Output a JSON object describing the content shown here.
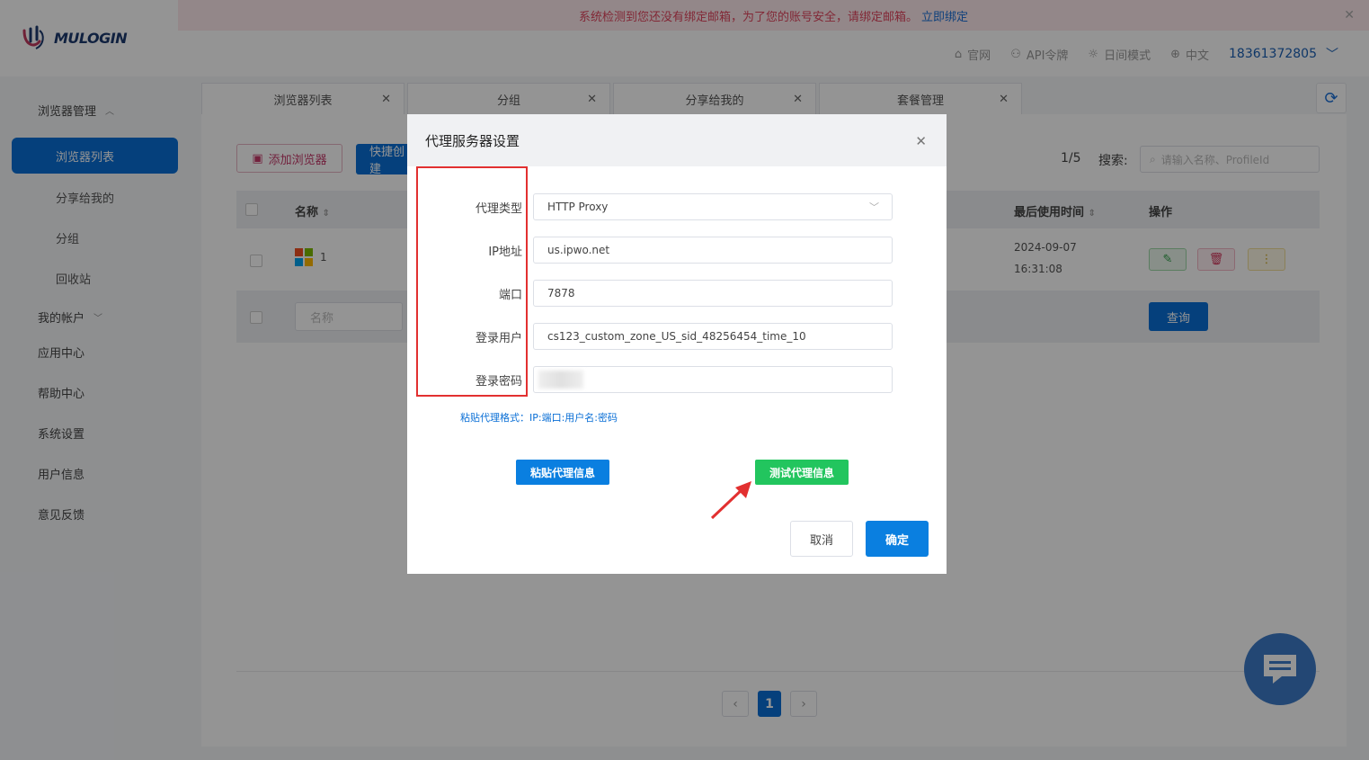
{
  "banner": {
    "message": "系统检测到您还没有绑定邮箱，为了您的账号安全，请绑定邮箱。",
    "link": "立即绑定"
  },
  "brand": {
    "name": "MULOGIN"
  },
  "topnav": {
    "items": [
      "官网",
      "API令牌",
      "日间模式",
      "中文"
    ],
    "phone": "18361372805"
  },
  "sidebar": {
    "group1": "浏览器管理",
    "active": "浏览器列表",
    "subs": [
      "分享给我的",
      "分组",
      "回收站"
    ],
    "items": [
      "我的帐户",
      "应用中心",
      "帮助中心",
      "系统设置",
      "用户信息",
      "意见反馈"
    ]
  },
  "tabs": [
    "浏览器列表",
    "分组",
    "分享给我的",
    "套餐管理"
  ],
  "toolbar": {
    "add_label": "添加浏览器",
    "quick_label": "快捷创建",
    "page_info": "1/5",
    "search_label": "搜索:",
    "search_placeholder": "请输入名称、ProfileId"
  },
  "table": {
    "headers": {
      "name": "名称",
      "last_used": "最后使用时间",
      "actions": "操作"
    },
    "row": {
      "name": "1",
      "last_used_date": "2024-09-07",
      "last_used_time": "16:31:08"
    },
    "filter_placeholder": "名称",
    "query_label": "查询"
  },
  "pagination": {
    "current": "1"
  },
  "modal": {
    "title": "代理服务器设置",
    "fields": {
      "type_label": "代理类型",
      "type_value": "HTTP Proxy",
      "ip_label": "IP地址",
      "ip_value": "us.ipwo.net",
      "port_label": "端口",
      "port_value": "7878",
      "user_label": "登录用户",
      "user_value": "cs123_custom_zone_US_sid_48256454_time_10",
      "pass_label": "登录密码"
    },
    "hint": "粘贴代理格式：IP:端口:用户名:密码",
    "paste_label": "粘贴代理信息",
    "test_label": "测试代理信息",
    "cancel_label": "取消",
    "ok_label": "确定"
  },
  "colors": {
    "primary": "#0a6fd6",
    "success": "#22c55e",
    "annotation": "#e23030"
  }
}
